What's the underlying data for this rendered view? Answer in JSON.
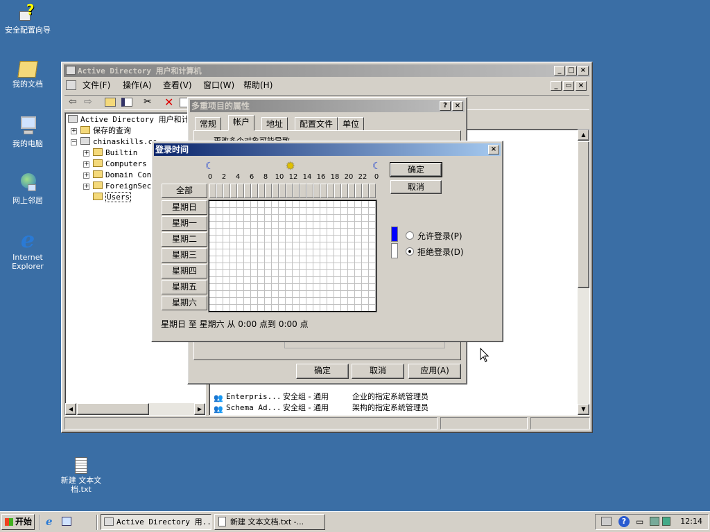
{
  "desktop": {
    "icons": [
      {
        "label": "安全配置向导"
      },
      {
        "label": "我的文档"
      },
      {
        "label": "我的电脑"
      },
      {
        "label": "网上邻居"
      },
      {
        "label": "Internet Explorer"
      },
      {
        "label": "新建 文本文档.txt"
      }
    ]
  },
  "ad_window": {
    "title": "Active Directory 用户和计算机",
    "menu": [
      "文件(F)",
      "操作(A)",
      "查看(V)",
      "窗口(W)",
      "帮助(H)"
    ],
    "tree": {
      "root": "Active Directory 用户和计",
      "saved": "保存的查询",
      "domain": "chinaskills.co",
      "children": [
        "Builtin",
        "Computers",
        "Domain Cont",
        "ForeignSecu",
        "Users"
      ]
    },
    "list_rows": [
      {
        "name": "Enterpris...",
        "type": "安全组 - 通用",
        "desc": "企业的指定系统管理员"
      },
      {
        "name": "Schema Ad...",
        "type": "安全组 - 通用",
        "desc": "架构的指定系统管理员"
      }
    ]
  },
  "props_dialog": {
    "title": "多重项目的属性",
    "tabs": [
      "常规",
      "帐户",
      "地址",
      "配置文件",
      "单位"
    ],
    "partial_text": "更改多个对象可能导致...",
    "buttons": {
      "ok": "确定",
      "cancel": "取消",
      "apply": "应用(A)"
    }
  },
  "logon_dialog": {
    "title": "登录时间",
    "hours": [
      "0",
      "2",
      "4",
      "6",
      "8",
      "10",
      "12",
      "14",
      "16",
      "18",
      "20",
      "22",
      "0"
    ],
    "all_label": "全部",
    "days": [
      "星期日",
      "星期一",
      "星期二",
      "星期三",
      "星期四",
      "星期五",
      "星期六"
    ],
    "buttons": {
      "ok": "确定",
      "cancel": "取消"
    },
    "radio_permit": "允许登录(P)",
    "radio_deny": "拒绝登录(D)",
    "selected": "deny",
    "status": "星期日 至 星期六 从 0:00 点到 0:00 点",
    "colors": {
      "permit": "#0000ff",
      "deny": "#ffffff"
    }
  },
  "taskbar": {
    "start": "开始",
    "tasks": [
      "Active Directory 用...",
      "新建 文本文档.txt -..."
    ],
    "clock": "12:14"
  }
}
